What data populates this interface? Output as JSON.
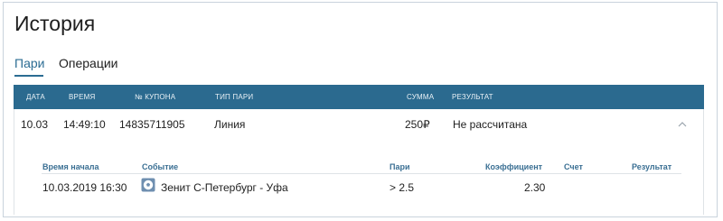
{
  "page": {
    "title": "История"
  },
  "tabs": [
    {
      "label": "Пари",
      "active": true
    },
    {
      "label": "Операции",
      "active": false
    }
  ],
  "table": {
    "headers": [
      "ДАТА",
      "ВРЕМЯ",
      "№ КУПОНА",
      "ТИП ПАРИ",
      "СУММА",
      "РЕЗУЛЬТАТ"
    ],
    "rows": [
      {
        "date": "10.03",
        "time": "14:49:10",
        "coupon": "14835711905",
        "bet_type": "Линия",
        "amount": "250₽",
        "result": "Не рассчитана",
        "details": {
          "headers": [
            "Время начала",
            "Событие",
            "Пари",
            "Коэффициент",
            "Счет",
            "Результат"
          ],
          "items": [
            {
              "start": "10.03.2019 16:30",
              "event": "Зенит С-Петербург - Уфа",
              "bet": "> 2.5",
              "odds": "2.30",
              "score": "",
              "result": ""
            }
          ]
        }
      }
    ]
  },
  "colors": {
    "accent": "#2b6c93",
    "header_bg": "#2b6a8f",
    "detail_header_text": "#3a6f93"
  },
  "icons": {
    "expand": "chevron-up-icon",
    "sport": "football-icon"
  }
}
